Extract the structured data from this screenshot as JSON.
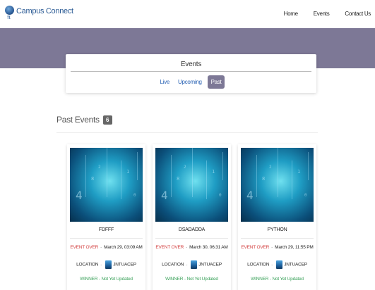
{
  "navbar": {
    "brand": "Campus Connect",
    "links": [
      "Home",
      "Events",
      "Contact Us"
    ]
  },
  "events_tabs": {
    "title": "Events",
    "tabs": [
      "Live",
      "Upcoming",
      "Past"
    ],
    "active": "Past"
  },
  "section": {
    "title": "Past Events",
    "count": "6"
  },
  "cards": [
    {
      "name": "FDFFF",
      "status": "EVENT OVER",
      "date": "March 29, 03:09 AM",
      "location_label": "LOCATION",
      "location": "JNTUACEP",
      "winner_label": "WINNER",
      "winner": "Not Yet Updated"
    },
    {
      "name": "DSADADDA",
      "status": "EVENT OVER",
      "date": "March 30, 06:31 AM",
      "location_label": "LOCATION",
      "location": "JNTUACEP",
      "winner_label": "WINNER",
      "winner": "Not Yet Updated"
    },
    {
      "name": "PYTHON",
      "status": "EVENT OVER",
      "date": "March 29, 11:55 PM",
      "location_label": "LOCATION",
      "location": "JNTUACEP",
      "winner_label": "WINNER",
      "winner": "Not Yet Updated"
    }
  ],
  "colors": {
    "banner": "#7d7896",
    "brand": "#2a5a94",
    "link": "#2b64b5",
    "event_over": "#d23b3b",
    "winner": "#3aa15a"
  },
  "icons": {
    "brand_logo": "globe-icon",
    "location_logo": "college-logo-icon"
  }
}
